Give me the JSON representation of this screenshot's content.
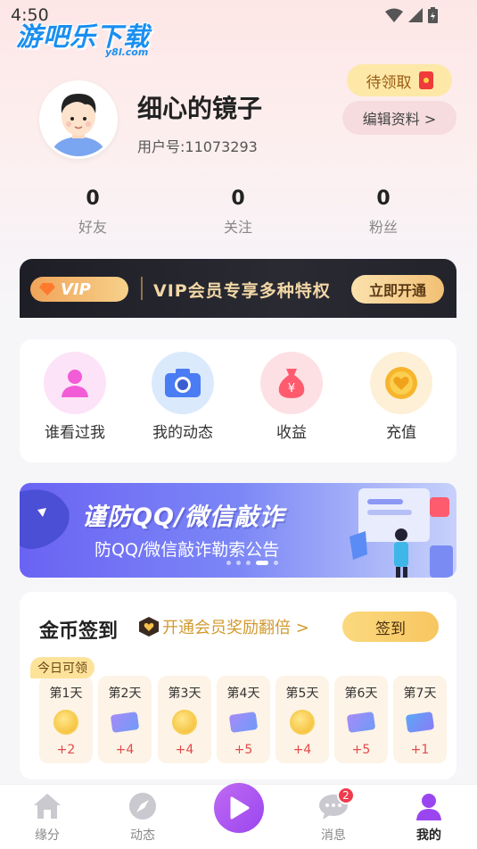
{
  "status_bar": {
    "time": "4:50"
  },
  "watermark": {
    "main": "游吧乐下载",
    "sub": "y8l.com"
  },
  "profile": {
    "name": "细心的镜子",
    "user_id": "用户号:11073293",
    "pending_label": "待领取",
    "edit_label": "编辑资料 >"
  },
  "stats": [
    {
      "value": "0",
      "label": "好友"
    },
    {
      "value": "0",
      "label": "关注"
    },
    {
      "value": "0",
      "label": "粉丝"
    }
  ],
  "vip": {
    "badge": "VIP",
    "text": "VIP会员专享多种特权",
    "button": "立即开通"
  },
  "quick_grid": [
    {
      "label": "谁看过我",
      "icon": "person-icon",
      "color": "#f25cd7"
    },
    {
      "label": "我的动态",
      "icon": "camera-icon",
      "color": "#4a7cf3"
    },
    {
      "label": "收益",
      "icon": "money-bag-icon",
      "color": "#ff5b6f"
    },
    {
      "label": "充值",
      "icon": "coin-icon",
      "color": "#f6b52c"
    }
  ],
  "ad_banner": {
    "title": "谨防QQ/微信敲诈",
    "subtitle": "防QQ/微信敲诈勒索公告",
    "active_dot": 3,
    "dot_count": 5
  },
  "checkin": {
    "title": "金币签到",
    "promo": "开通会员奖励翻倍 >",
    "button": "签到",
    "today_tag": "今日可领",
    "days": [
      {
        "label": "第1天",
        "reward": "+2",
        "icon": "coin"
      },
      {
        "label": "第2天",
        "reward": "+4",
        "icon": "ticket"
      },
      {
        "label": "第3天",
        "reward": "+4",
        "icon": "coin"
      },
      {
        "label": "第4天",
        "reward": "+5",
        "icon": "ticket"
      },
      {
        "label": "第5天",
        "reward": "+4",
        "icon": "coin"
      },
      {
        "label": "第6天",
        "reward": "+5",
        "icon": "ticket"
      },
      {
        "label": "第7天",
        "reward": "+1",
        "icon": "ticket"
      }
    ]
  },
  "bottom_nav": {
    "items": [
      {
        "label": "缘分",
        "icon": "home-icon"
      },
      {
        "label": "动态",
        "icon": "compass-icon"
      },
      {
        "label": "",
        "icon": "play-icon"
      },
      {
        "label": "消息",
        "icon": "chat-icon",
        "badge": "2"
      },
      {
        "label": "我的",
        "icon": "profile-icon",
        "active": true
      }
    ]
  },
  "colors": {
    "accent": "#9a46f0",
    "gold": "#f7c660",
    "vip_dark": "#23232b"
  }
}
